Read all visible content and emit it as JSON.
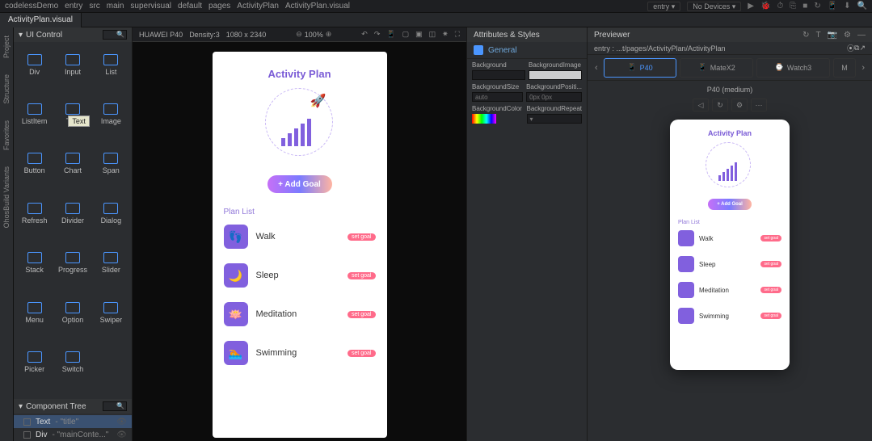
{
  "breadcrumbs": [
    "codelessDemo",
    "entry",
    "src",
    "main",
    "supervisual",
    "default",
    "pages",
    "ActivityPlan",
    "ActivityPlan.visual"
  ],
  "entry_dd": "entry ▾",
  "devices_dd": "No Devices ▾",
  "tabs": {
    "active": "ActivityPlan.visual"
  },
  "ui_control_title": "UI Control",
  "controls": [
    {
      "icon": "div-icon",
      "label": "Div"
    },
    {
      "icon": "input-icon",
      "label": "Input"
    },
    {
      "icon": "list-icon",
      "label": "List"
    },
    {
      "icon": "listitem-icon",
      "label": "ListItem"
    },
    {
      "icon": "text-icon",
      "label": "Text"
    },
    {
      "icon": "image-icon",
      "label": "Image"
    },
    {
      "icon": "button-icon",
      "label": "Button"
    },
    {
      "icon": "chart-icon",
      "label": "Chart"
    },
    {
      "icon": "span-icon",
      "label": "Span"
    },
    {
      "icon": "refresh-icon",
      "label": "Refresh"
    },
    {
      "icon": "divider-icon",
      "label": "Divider"
    },
    {
      "icon": "dialog-icon",
      "label": "Dialog"
    },
    {
      "icon": "stack-icon",
      "label": "Stack"
    },
    {
      "icon": "progress-icon",
      "label": "Progress"
    },
    {
      "icon": "slider-icon",
      "label": "Slider"
    },
    {
      "icon": "menu-icon",
      "label": "Menu"
    },
    {
      "icon": "option-icon",
      "label": "Option"
    },
    {
      "icon": "swiper-icon",
      "label": "Swiper"
    },
    {
      "icon": "picker-icon",
      "label": "Picker"
    },
    {
      "icon": "switch-icon",
      "label": "Switch"
    }
  ],
  "tooltip": "Text",
  "component_tree_title": "Component Tree",
  "tree": [
    {
      "type": "Text",
      "name": "\"title\"",
      "selected": true
    },
    {
      "type": "Div",
      "name": "\"mainConte...\"",
      "selected": false
    }
  ],
  "canvas": {
    "device": "HUAWEI P40",
    "density": "Density:3",
    "resolution": "1080 x 2340",
    "zoom": "100%"
  },
  "app": {
    "title": "Activity Plan",
    "add_goal": "+ Add Goal",
    "plan_list": "Plan List",
    "items": [
      {
        "name": "Walk",
        "badge": "set goal",
        "glyph": "👣"
      },
      {
        "name": "Sleep",
        "badge": "set goal",
        "glyph": "🌙"
      },
      {
        "name": "Meditation",
        "badge": "set goal",
        "glyph": "🪷"
      },
      {
        "name": "Swimming",
        "badge": "set goal",
        "glyph": "🏊"
      }
    ]
  },
  "attrs": {
    "title": "Attributes & Styles",
    "general": "General",
    "props": {
      "Background": "",
      "BackgroundImage": "",
      "BackgroundSize": "auto",
      "BackgroundPositi": "0px 0px",
      "BackgroundColor": "",
      "BackgroundRepeat": ""
    }
  },
  "previewer": {
    "title": "Previewer",
    "path": "entry : ...t/pages/ActivityPlan/ActivityPlan",
    "devices": [
      {
        "name": "P40",
        "active": true
      },
      {
        "name": "MateX2",
        "active": false
      },
      {
        "name": "Watch3",
        "active": false
      },
      {
        "name": "M",
        "active": false
      }
    ],
    "device_label": "P40 (medium)"
  },
  "left_tabs": [
    "Project",
    "Structure",
    "Favorites",
    "OhosBuild Variants"
  ]
}
